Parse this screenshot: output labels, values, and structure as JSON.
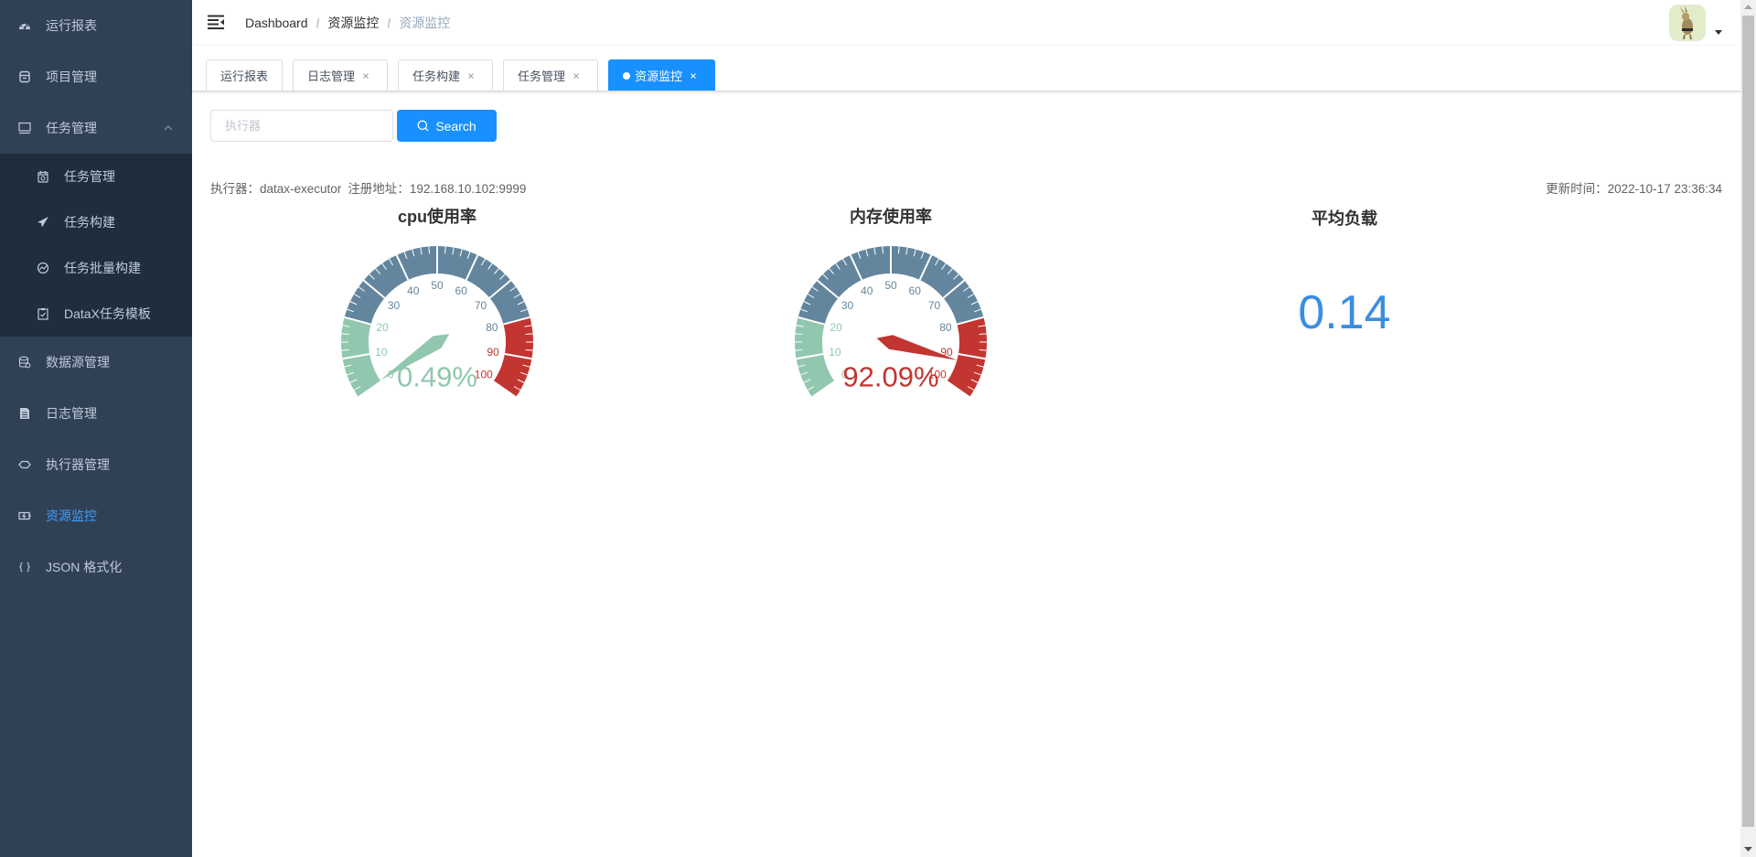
{
  "sidebar": {
    "items": [
      {
        "label": "运行报表",
        "icon": "dashboard-icon"
      },
      {
        "label": "项目管理",
        "icon": "project-icon"
      },
      {
        "label": "任务管理",
        "icon": "monitor-icon",
        "expanded": true,
        "children": [
          {
            "label": "任务管理",
            "icon": "calendar-icon"
          },
          {
            "label": "任务构建",
            "icon": "paper-plane-icon"
          },
          {
            "label": "任务批量构建",
            "icon": "batch-icon"
          },
          {
            "label": "DataX任务模板",
            "icon": "clipboard-icon"
          }
        ]
      },
      {
        "label": "数据源管理",
        "icon": "database-icon"
      },
      {
        "label": "日志管理",
        "icon": "document-icon"
      },
      {
        "label": "执行器管理",
        "icon": "executor-icon"
      },
      {
        "label": "资源监控",
        "icon": "resource-monitor-icon",
        "active": true
      },
      {
        "label": "JSON 格式化",
        "icon": "braces-icon"
      }
    ],
    "active_color": "#409EFF"
  },
  "navbar": {
    "breadcrumb": [
      "Dashboard",
      "资源监控",
      "资源监控"
    ],
    "separator": "/"
  },
  "tags": [
    {
      "label": "运行报表",
      "closable": false
    },
    {
      "label": "日志管理",
      "closable": true
    },
    {
      "label": "任务构建",
      "closable": true
    },
    {
      "label": "任务管理",
      "closable": true
    },
    {
      "label": "资源监控",
      "closable": true,
      "active": true
    }
  ],
  "search": {
    "placeholder": "执行器",
    "value": "",
    "button_label": "Search"
  },
  "info": {
    "executor_label": "执行器：",
    "executor_value": "datax-executor",
    "address_label": "注册地址：",
    "address_value": "192.168.10.102:9999",
    "updated_label": "更新时间：",
    "updated_value": "2022-10-17 23:36:34"
  },
  "colors": {
    "primary_button": "#1890ff",
    "sidebar_bg": "#304156",
    "load_value": "#3a8ee0"
  },
  "chart_data": [
    {
      "type": "gauge",
      "title": "cpu使用率",
      "min": 0,
      "max": 100,
      "value": 0.49,
      "unit": "%",
      "split_number": 10,
      "axis_labels": [
        "0",
        "10",
        "20",
        "30",
        "40",
        "50",
        "60",
        "70",
        "80",
        "90",
        "100"
      ],
      "bands": [
        {
          "to": 20,
          "color": "#91c7ae"
        },
        {
          "to": 80,
          "color": "#63869e"
        },
        {
          "to": 100,
          "color": "#c23531"
        }
      ]
    },
    {
      "type": "gauge",
      "title": "内存使用率",
      "min": 0,
      "max": 100,
      "value": 92.09,
      "unit": "%",
      "split_number": 10,
      "axis_labels": [
        "0",
        "10",
        "20",
        "30",
        "40",
        "50",
        "60",
        "70",
        "80",
        "90",
        "100"
      ],
      "bands": [
        {
          "to": 20,
          "color": "#91c7ae"
        },
        {
          "to": 80,
          "color": "#63869e"
        },
        {
          "to": 100,
          "color": "#c23531"
        }
      ]
    },
    {
      "type": "stat",
      "title": "平均负载",
      "value": "0.14",
      "color": "#3a8ee0"
    }
  ]
}
